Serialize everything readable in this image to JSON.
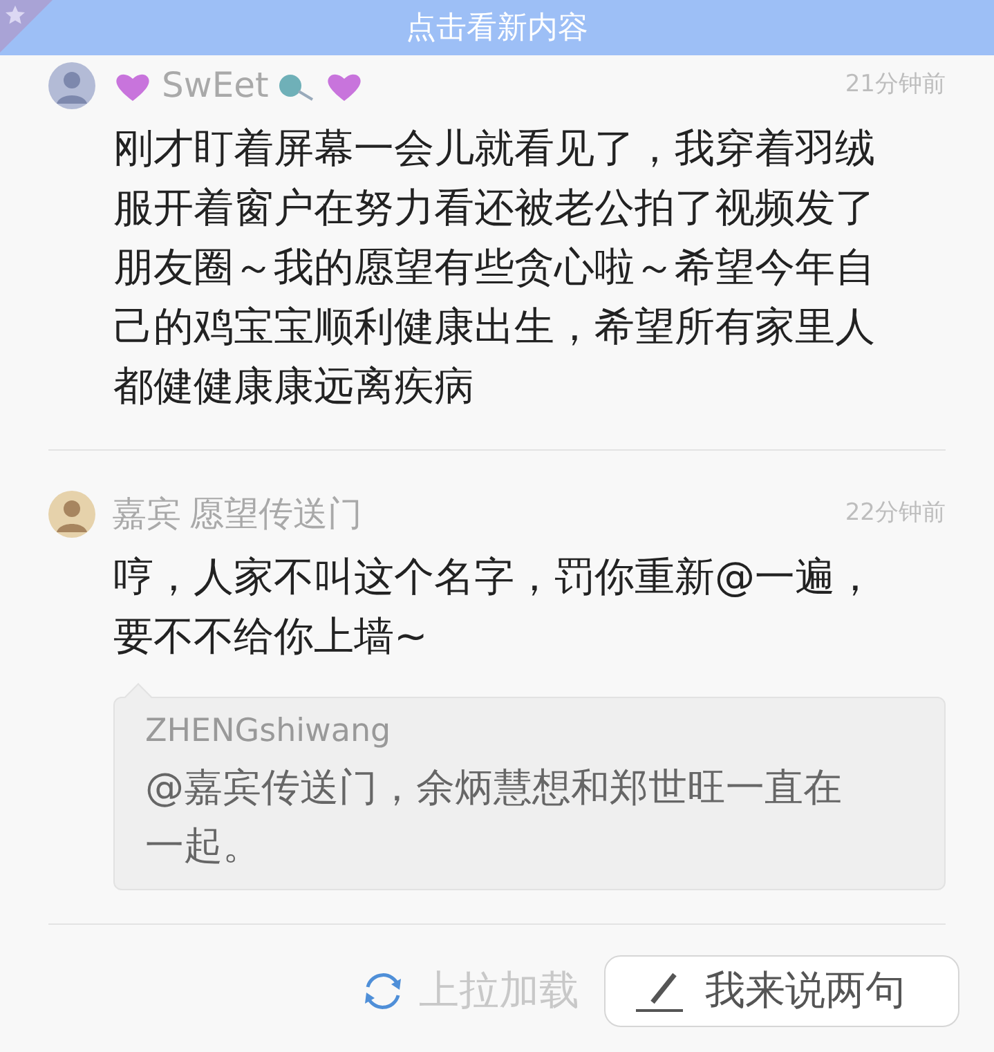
{
  "banner": {
    "text": "点击看新内容"
  },
  "comments": [
    {
      "decorated": true,
      "author": "SwEet",
      "time": "21分钟前",
      "text": "刚才盯着屏幕一会儿就看见了，我穿着羽绒服开着窗户在努力看还被老公拍了视频发了朋友圈～我的愿望有些贪心啦～希望今年自己的鸡宝宝顺利健康出生，希望所有家里人都健健康康远离疾病"
    },
    {
      "decorated": false,
      "badge": "嘉宾",
      "author": "愿望传送门",
      "time": "22分钟前",
      "text": "哼，人家不叫这个名字，罚你重新@一遍，要不不给你上墙~",
      "quote": {
        "author": "ZHENGshiwang",
        "text": "@嘉宾传送门，余炳慧想和郑世旺一直在一起。"
      }
    }
  ],
  "footer": {
    "loading": "上拉加载",
    "compose_button": "我来说两句"
  }
}
